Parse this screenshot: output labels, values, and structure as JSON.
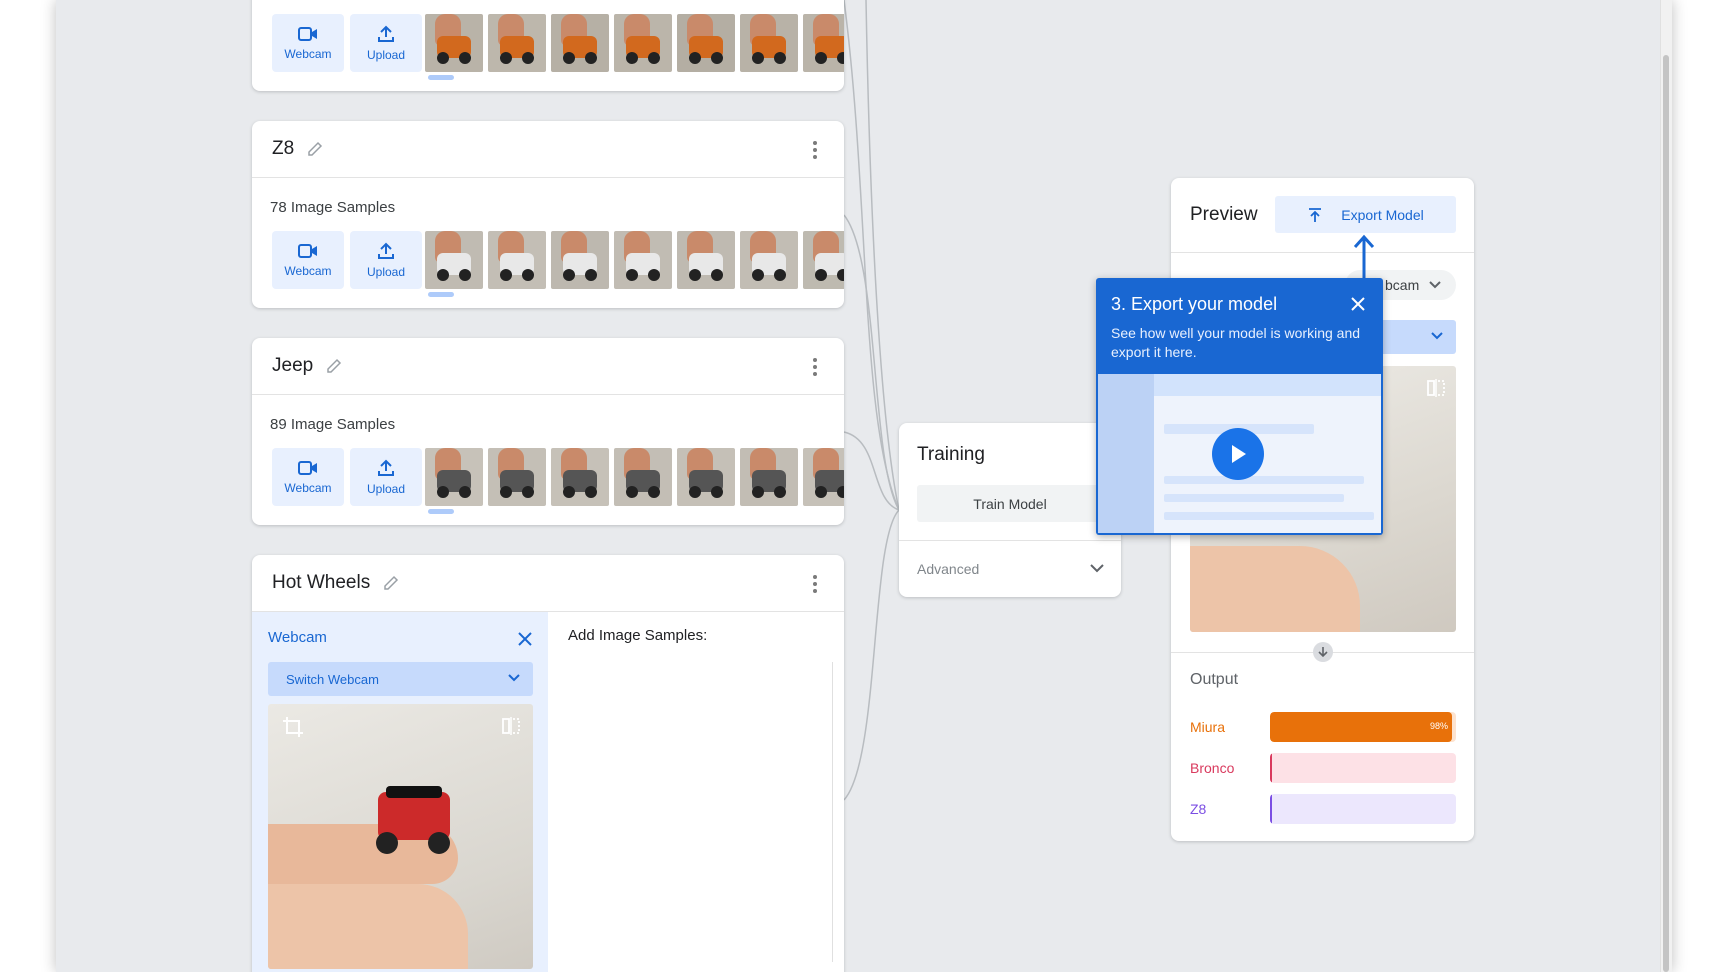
{
  "classes": [
    {
      "name": "",
      "sample_count": "",
      "webcam_label": "Webcam",
      "upload_label": "Upload"
    },
    {
      "name": "Z8",
      "sample_count": "78 Image Samples",
      "webcam_label": "Webcam",
      "upload_label": "Upload"
    },
    {
      "name": "Jeep",
      "sample_count": "89 Image Samples",
      "webcam_label": "Webcam",
      "upload_label": "Upload"
    },
    {
      "name": "Hot Wheels",
      "webcam_panel_title": "Webcam",
      "switch_webcam": "Switch Webcam",
      "add_samples": "Add Image Samples:"
    }
  ],
  "training": {
    "title": "Training",
    "train_button": "Train Model",
    "advanced": "Advanced"
  },
  "preview": {
    "title": "Preview",
    "export_button": "Export Model",
    "input_pill": "bcam",
    "output_title": "Output",
    "outputs": [
      {
        "label": "Miura",
        "value": 0.98,
        "percent_label": "98%",
        "color": "#e8710a",
        "track": "#fde3cf"
      },
      {
        "label": "Bronco",
        "value": 0.0,
        "percent_label": "",
        "color": "#d93a5e",
        "track": "#fde1e6"
      },
      {
        "label": "Z8",
        "value": 0.0,
        "percent_label": "",
        "color": "#7b4ee3",
        "track": "#ece7fd"
      }
    ]
  },
  "tooltip": {
    "title": "3. Export your model",
    "body": "See how well your model is working and export it here."
  },
  "colors": {
    "accent": "#1967d2",
    "accent_light": "#e8f0fe",
    "background": "#e8eaed"
  },
  "icons": [
    "webcam-icon",
    "upload-icon",
    "pencil-icon",
    "kebab-menu-icon",
    "close-icon",
    "chevron-down-icon",
    "flip-icon",
    "crop-icon",
    "play-icon",
    "arrow-down-icon",
    "export-upload-icon"
  ]
}
